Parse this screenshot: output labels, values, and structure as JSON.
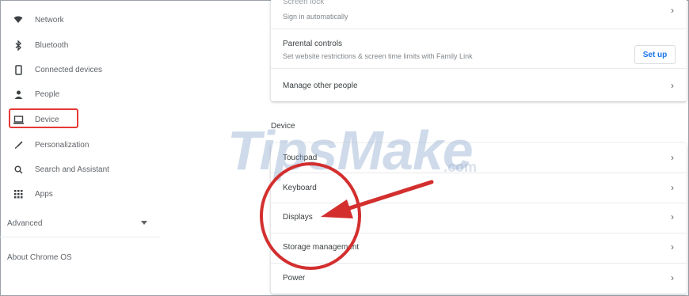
{
  "sidebar": {
    "items": [
      {
        "label": "Network",
        "icon": "wifi-icon"
      },
      {
        "label": "Bluetooth",
        "icon": "bluetooth-icon"
      },
      {
        "label": "Connected devices",
        "icon": "phone-icon"
      },
      {
        "label": "People",
        "icon": "person-icon"
      },
      {
        "label": "Device",
        "icon": "laptop-icon"
      },
      {
        "label": "Personalization",
        "icon": "brush-icon"
      },
      {
        "label": "Search and Assistant",
        "icon": "search-icon"
      },
      {
        "label": "Apps",
        "icon": "apps-grid-icon"
      }
    ],
    "advanced_label": "Advanced",
    "about_label": "About Chrome OS"
  },
  "people_card": {
    "screen_lock_title": "Screen lock",
    "screen_lock_sub": "Sign in automatically",
    "parental_title": "Parental controls",
    "parental_sub": "Set website restrictions & screen time limits with Family Link",
    "setup_label": "Set up",
    "manage_label": "Manage other people"
  },
  "device_section": {
    "heading": "Device",
    "rows": [
      "Touchpad",
      "Keyboard",
      "Displays",
      "Storage management",
      "Power"
    ]
  },
  "chevron_glyph": "›",
  "watermark": {
    "text": "TipsMake",
    "domain": ".com"
  },
  "colors": {
    "highlight_red": "#e53935",
    "annotation_red": "#d32f2f",
    "accent_blue": "#1a73e8"
  }
}
